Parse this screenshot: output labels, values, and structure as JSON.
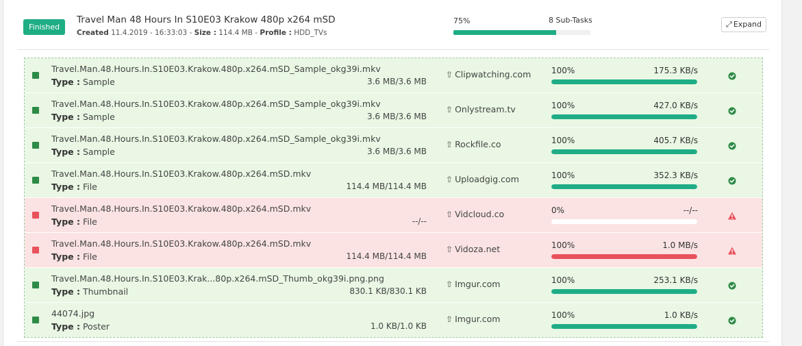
{
  "header": {
    "status": "Finished",
    "title": "Travel Man 48 Hours In S10E03 Krakow 480p x264 mSD",
    "created_label": "Created",
    "created_value": "11.4.2019 - 16:33:03",
    "size_label": "Size :",
    "size_value": "114.4 MB",
    "profile_label": "Profile :",
    "profile_value": "HDD_TVs",
    "progress_label": "75%",
    "progress_fraction": 0.75,
    "subtasks": "8 Sub-Tasks",
    "expand_label": "Expand",
    "expand_icon": "expand-arrows-icon"
  },
  "type_label": "Type :",
  "colors": {
    "success": "#1fad86",
    "error": "#e8525c",
    "row_ok_bg": "#e9f7e4",
    "row_err_bg": "#fbe3e3",
    "square_ok": "#2e8b47"
  },
  "rows": [
    {
      "filename": "Travel.Man.48.Hours.In.S10E03.Krakow.480p.x264.mSD_Sample_okg39i.mkv",
      "type": "Sample",
      "size": "3.6 MB/3.6 MB",
      "host": "Clipwatching.com",
      "percent": "100%",
      "fraction": 1.0,
      "speed": "175.3 KB/s",
      "status": "ok"
    },
    {
      "filename": "Travel.Man.48.Hours.In.S10E03.Krakow.480p.x264.mSD_Sample_okg39i.mkv",
      "type": "Sample",
      "size": "3.6 MB/3.6 MB",
      "host": "Onlystream.tv",
      "percent": "100%",
      "fraction": 1.0,
      "speed": "427.0 KB/s",
      "status": "ok"
    },
    {
      "filename": "Travel.Man.48.Hours.In.S10E03.Krakow.480p.x264.mSD_Sample_okg39i.mkv",
      "type": "Sample",
      "size": "3.6 MB/3.6 MB",
      "host": "Rockfile.co",
      "percent": "100%",
      "fraction": 1.0,
      "speed": "405.7 KB/s",
      "status": "ok"
    },
    {
      "filename": "Travel.Man.48.Hours.In.S10E03.Krakow.480p.x264.mSD.mkv",
      "type": "File",
      "size": "114.4 MB/114.4 MB",
      "host": "Uploadgig.com",
      "percent": "100%",
      "fraction": 1.0,
      "speed": "352.3 KB/s",
      "status": "ok"
    },
    {
      "filename": "Travel.Man.48.Hours.In.S10E03.Krakow.480p.x264.mSD.mkv",
      "type": "File",
      "size": "--/--",
      "host": "Vidcloud.co",
      "percent": "0%",
      "fraction": 0.0,
      "speed": "--/--",
      "status": "err"
    },
    {
      "filename": "Travel.Man.48.Hours.In.S10E03.Krakow.480p.x264.mSD.mkv",
      "type": "File",
      "size": "114.4 MB/114.4 MB",
      "host": "Vidoza.net",
      "percent": "100%",
      "fraction": 1.0,
      "speed": "1.0 MB/s",
      "status": "err"
    },
    {
      "filename": "Travel.Man.48.Hours.In.S10E03.Krak...80p.x264.mSD_Thumb_okg39i.png.png",
      "type": "Thumbnail",
      "size": "830.1 KB/830.1 KB",
      "host": "Imgur.com",
      "percent": "100%",
      "fraction": 1.0,
      "speed": "253.1 KB/s",
      "status": "ok"
    },
    {
      "filename": "44074.jpg",
      "type": "Poster",
      "size": "1.0 KB/1.0 KB",
      "host": "Imgur.com",
      "percent": "100%",
      "fraction": 1.0,
      "speed": "1.0 KB/s",
      "status": "ok"
    }
  ]
}
